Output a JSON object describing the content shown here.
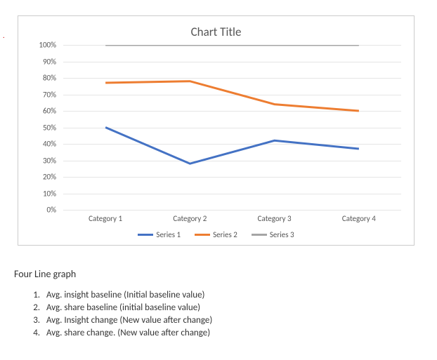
{
  "red_mark": ".",
  "chart_data": {
    "type": "line",
    "title": "Chart Title",
    "xlabel": "",
    "ylabel": "",
    "categories": [
      "Category 1",
      "Category 2",
      "Category 3",
      "Category 4"
    ],
    "series": [
      {
        "name": "Series 1",
        "color": "#4472c4",
        "values": [
          50,
          28,
          42,
          37
        ]
      },
      {
        "name": "Series 2",
        "color": "#ed7d31",
        "values": [
          77,
          78,
          64,
          60
        ]
      },
      {
        "name": "Series 3",
        "color": "#a5a5a5",
        "values": [
          100,
          100,
          100,
          100
        ]
      }
    ],
    "y_ticks": [
      "0%",
      "10%",
      "20%",
      "30%",
      "40%",
      "50%",
      "60%",
      "70%",
      "80%",
      "90%",
      "100%"
    ],
    "ylim": [
      0,
      100
    ]
  },
  "section_title": "Four Line graph",
  "notes": [
    "Avg. insight baseline (Initial baseline value)",
    "Avg. share baseline (initial baseline value)",
    "Avg. Insight change (New value after change)",
    "Avg. share change. (New value after change)"
  ]
}
